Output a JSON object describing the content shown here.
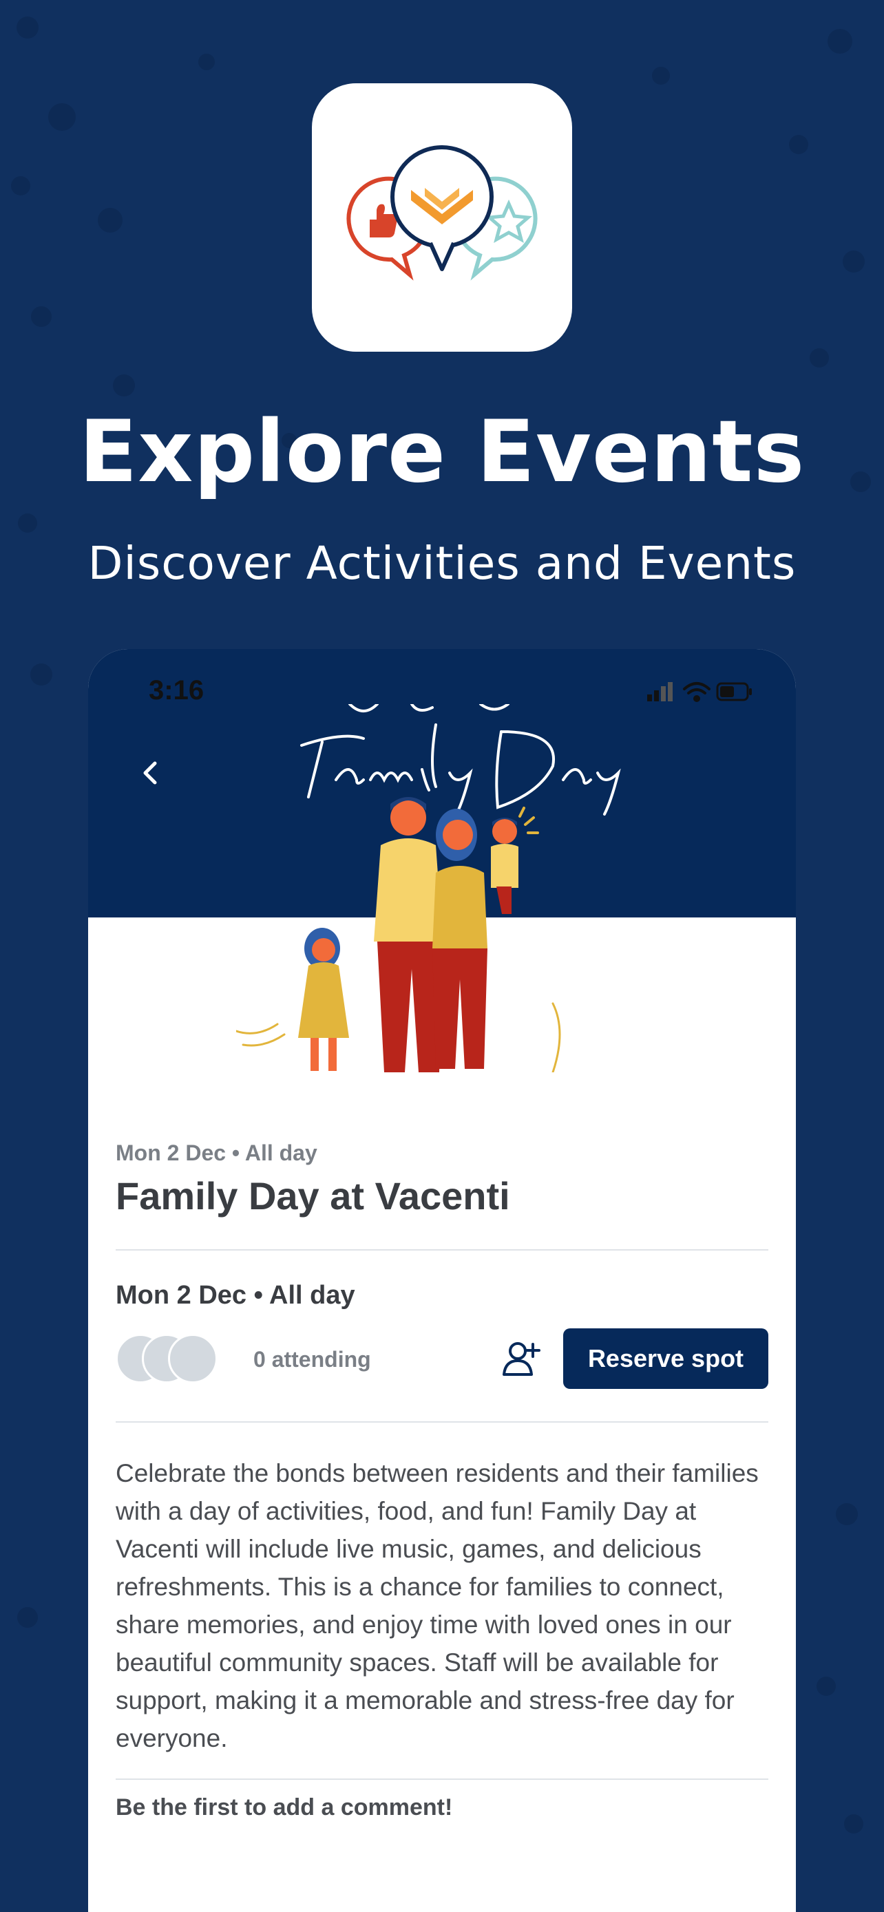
{
  "promo": {
    "title": "Explore Events",
    "subtitle": "Discover Activities and Events"
  },
  "colors": {
    "background": "#10305f",
    "hero": "#06295a",
    "button": "#06295a",
    "logo_red": "#d8442a",
    "logo_navy": "#0f2a55",
    "logo_teal": "#8fd0cf",
    "logo_orange": "#f29a2e"
  },
  "status_bar": {
    "time": "3:16",
    "icons": [
      "signal-icon",
      "wifi-icon",
      "battery-icon"
    ]
  },
  "event": {
    "hero_script": "Family Day",
    "date_small": "Mon 2 Dec • All day",
    "title": "Family Day at Vacenti",
    "date_row": "Mon 2 Dec • All day",
    "attending": "0 attending",
    "reserve_label": "Reserve spot",
    "description": "Celebrate the bonds between residents and their families with a day of activities, food, and fun! Family Day at Vacenti will include live music, games, and delicious refreshments. This is a chance for families to connect, share memories, and enjoy time with loved ones in our beautiful community spaces. Staff will be available for support, making it a memorable and stress-free day for everyone.",
    "comment_prompt": "Be the first to add a comment!"
  }
}
